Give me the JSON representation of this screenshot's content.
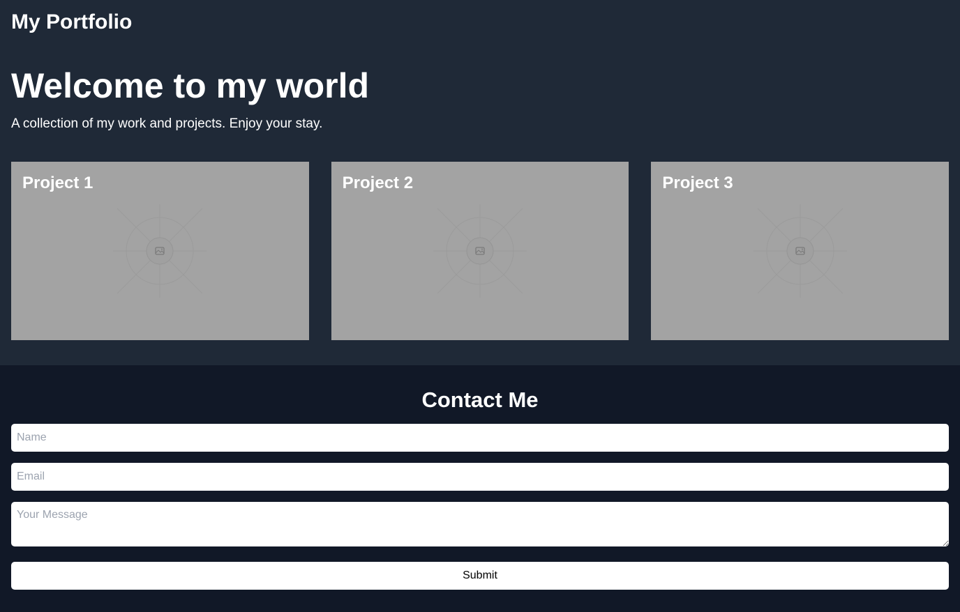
{
  "header": {
    "brand": "My Portfolio"
  },
  "hero": {
    "title": "Welcome to my world",
    "subtitle": "A collection of my work and projects. Enjoy your stay."
  },
  "projects": [
    {
      "title": "Project 1",
      "icon": "image-placeholder-icon"
    },
    {
      "title": "Project 2",
      "icon": "image-placeholder-icon"
    },
    {
      "title": "Project 3",
      "icon": "image-placeholder-icon"
    }
  ],
  "contact": {
    "title": "Contact Me",
    "name_placeholder": "Name",
    "email_placeholder": "Email",
    "message_placeholder": "Your Message",
    "submit_label": "Submit"
  },
  "colors": {
    "top_background": "#1f2937",
    "contact_background": "#111827",
    "card_background": "#a3a3a3",
    "text": "#ffffff"
  }
}
